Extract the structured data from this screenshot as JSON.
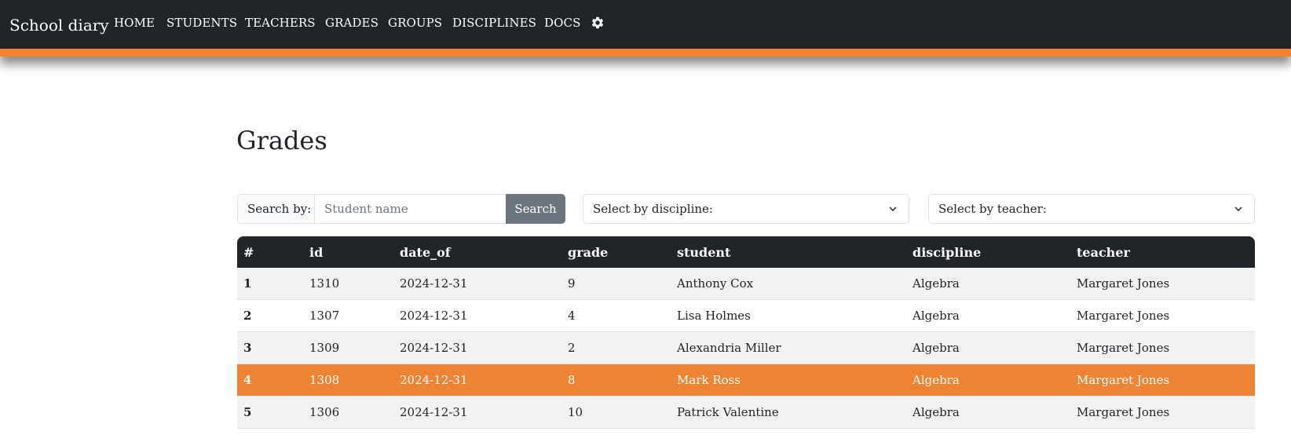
{
  "navbar": {
    "brand": "School diary",
    "links": [
      "HOME",
      "STUDENTS",
      "TEACHERS",
      "GRADES",
      "GROUPS",
      "DISCIPLINES",
      "DOCS"
    ],
    "settings_icon": "gear-icon",
    "accent_color": "#f0842c"
  },
  "page": {
    "title": "Grades"
  },
  "filters": {
    "search_label": "Search by:",
    "search_placeholder": "Student name",
    "search_value": "",
    "search_button": "Search",
    "discipline_select": "Select by discipline:",
    "teacher_select": "Select by teacher:"
  },
  "table": {
    "columns": [
      "#",
      "id",
      "date_of",
      "grade",
      "student",
      "discipline",
      "teacher"
    ],
    "highlight_color": "#ee8433",
    "rows": [
      {
        "num": "1",
        "id": "1310",
        "date_of": "2024-12-31",
        "grade": "9",
        "student": "Anthony Cox",
        "discipline": "Algebra",
        "teacher": "Margaret Jones"
      },
      {
        "num": "2",
        "id": "1307",
        "date_of": "2024-12-31",
        "grade": "4",
        "student": "Lisa Holmes",
        "discipline": "Algebra",
        "teacher": "Margaret Jones"
      },
      {
        "num": "3",
        "id": "1309",
        "date_of": "2024-12-31",
        "grade": "2",
        "student": "Alexandria Miller",
        "discipline": "Algebra",
        "teacher": "Margaret Jones"
      },
      {
        "num": "4",
        "id": "1308",
        "date_of": "2024-12-31",
        "grade": "8",
        "student": "Mark Ross",
        "discipline": "Algebra",
        "teacher": "Margaret Jones"
      },
      {
        "num": "5",
        "id": "1306",
        "date_of": "2024-12-31",
        "grade": "10",
        "student": "Patrick Valentine",
        "discipline": "Algebra",
        "teacher": "Margaret Jones"
      }
    ]
  }
}
